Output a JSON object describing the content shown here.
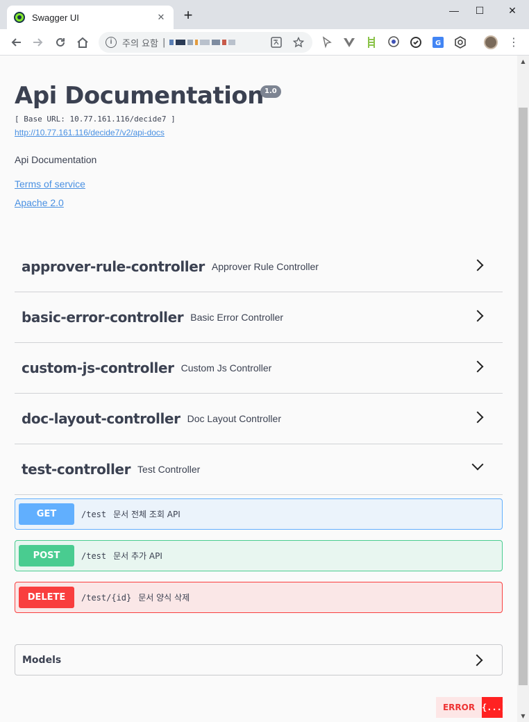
{
  "browser": {
    "tab_title": "Swagger UI",
    "tab_close": "✕",
    "new_tab": "+",
    "minimize": "—",
    "maximize": "☐",
    "close": "✕",
    "security_label": "주의 요함"
  },
  "api": {
    "title": "Api Documentation",
    "version": "1.0",
    "base_url": "[ Base URL: 10.77.161.116/decide7 ]",
    "docs_link": "http://10.77.161.116/decide7/v2/api-docs",
    "description": "Api Documentation",
    "terms_label": "Terms of service",
    "license_label": "Apache 2.0"
  },
  "tags": [
    {
      "name": "approver-rule-controller",
      "description": "Approver Rule Controller",
      "expanded": false
    },
    {
      "name": "basic-error-controller",
      "description": "Basic Error Controller",
      "expanded": false
    },
    {
      "name": "custom-js-controller",
      "description": "Custom Js Controller",
      "expanded": false
    },
    {
      "name": "doc-layout-controller",
      "description": "Doc Layout Controller",
      "expanded": false
    },
    {
      "name": "test-controller",
      "description": "Test Controller",
      "expanded": true
    }
  ],
  "operations": [
    {
      "method": "GET",
      "path": "/test",
      "summary": "문서 전체 조회 API"
    },
    {
      "method": "POST",
      "path": "/test",
      "summary": "문서 추가 API"
    },
    {
      "method": "DELETE",
      "path": "/test/{id}",
      "summary": "문서 양식 삭제"
    }
  ],
  "models": {
    "title": "Models"
  },
  "validator": {
    "label": "ERROR",
    "icon_text": "{...}"
  },
  "colors": {
    "get": "#61affe",
    "post": "#49cc90",
    "delete": "#f93e3e",
    "link": "#4990e2",
    "text": "#3b4151"
  }
}
